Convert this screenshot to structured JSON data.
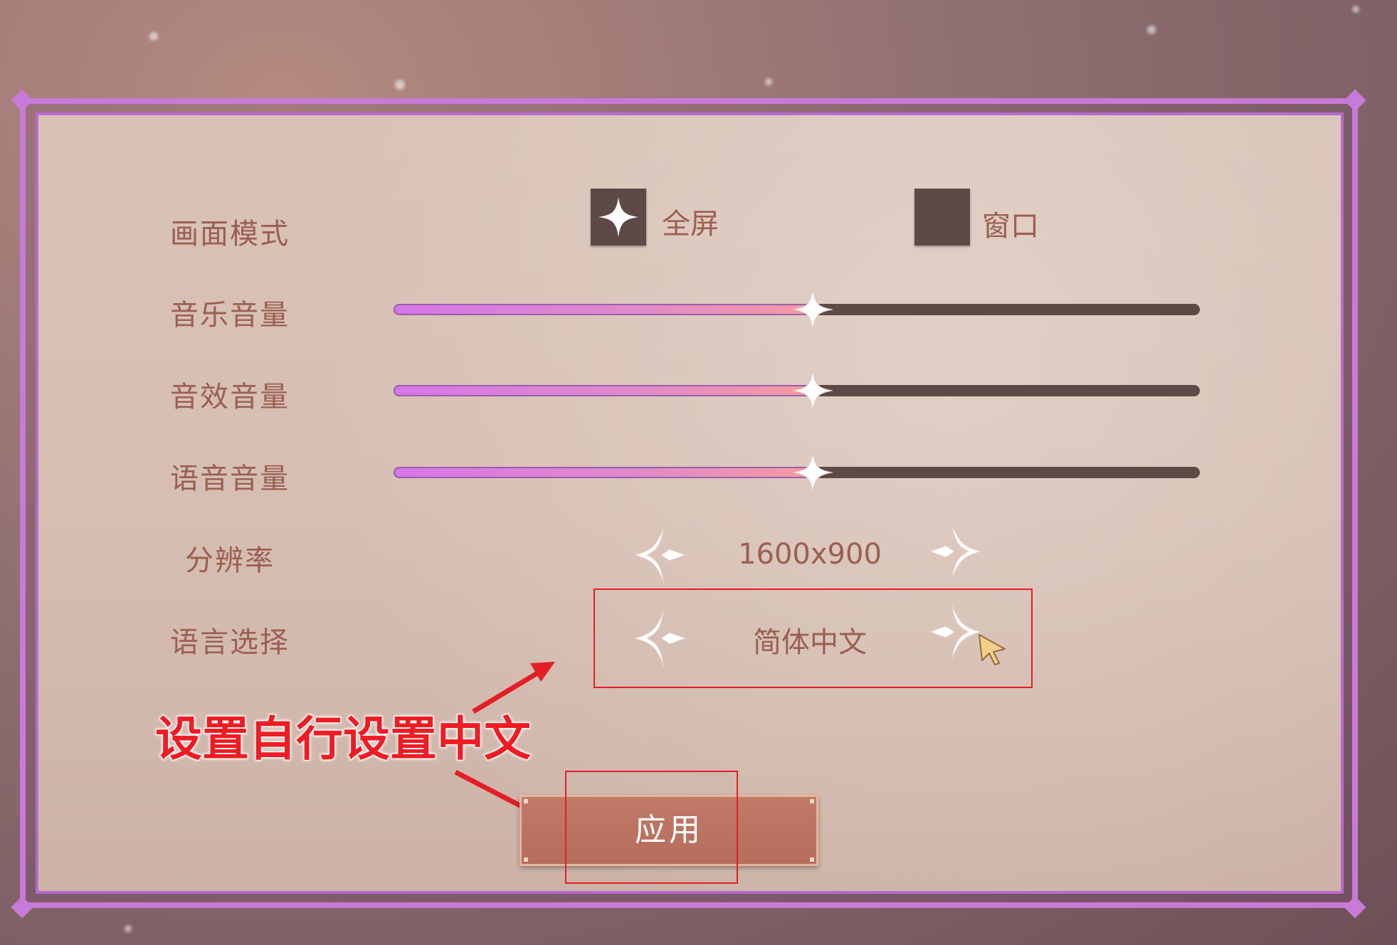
{
  "settings": {
    "display_mode": {
      "label": "画面模式",
      "options": [
        {
          "label": "全屏",
          "selected": true
        },
        {
          "label": "窗口",
          "selected": false
        }
      ]
    },
    "music_volume": {
      "label": "音乐音量",
      "value": 0.52
    },
    "sfx_volume": {
      "label": "音效音量",
      "value": 0.52
    },
    "voice_volume": {
      "label": "语音音量",
      "value": 0.52
    },
    "resolution": {
      "label": "分辨率",
      "value": "1600x900"
    },
    "language": {
      "label": "语言选择",
      "value": "简体中文"
    }
  },
  "annotation": {
    "text": "设置自行设置中文",
    "color": "#ee1c24"
  },
  "apply_button": {
    "label": "应用"
  },
  "colors": {
    "frame": "#c87ad8",
    "label": "#9b5f52",
    "button": "#b56d5c",
    "highlight": "#e41e26"
  },
  "icons": [
    "diamond-check-icon",
    "left-arrow-icon",
    "right-arrow-icon",
    "cursor-icon",
    "red-arrow-icon"
  ]
}
